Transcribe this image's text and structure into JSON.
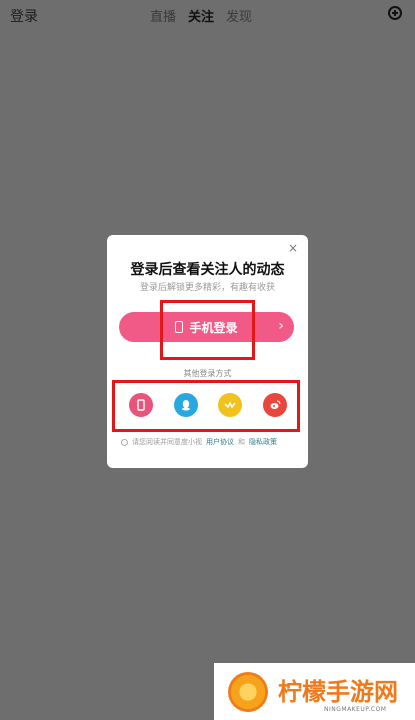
{
  "topbar": {
    "login_label": "登录",
    "tabs": [
      {
        "label": "直播",
        "active": false
      },
      {
        "label": "关注",
        "active": true
      },
      {
        "label": "发现",
        "active": false
      }
    ],
    "add_icon": "plus-circle-icon"
  },
  "modal": {
    "title": "登录后查看关注人的动态",
    "subtitle": "登录后解锁更多精彩，有趣有收获",
    "close": "×",
    "phone_login_label": "手机登录",
    "other_methods_label": "其他登录方式",
    "methods": [
      {
        "name": "phone",
        "color": "#e8547a"
      },
      {
        "name": "qq",
        "color": "#27a8e0"
      },
      {
        "name": "wechat",
        "color": "#f1c21b"
      },
      {
        "name": "weibo",
        "color": "#e9463d"
      }
    ],
    "agreement": {
      "prefix": "请您阅读并同意度小视",
      "user_agreement": "用户协议",
      "and": "和",
      "privacy_policy": "隐私政策"
    }
  },
  "watermark": {
    "brand": "柠檬手游网",
    "url": "NINGMAKEUP.COM"
  },
  "colors": {
    "accent": "#f15a86",
    "overlay": "#6e6e6e",
    "highlight": "#e21717"
  }
}
